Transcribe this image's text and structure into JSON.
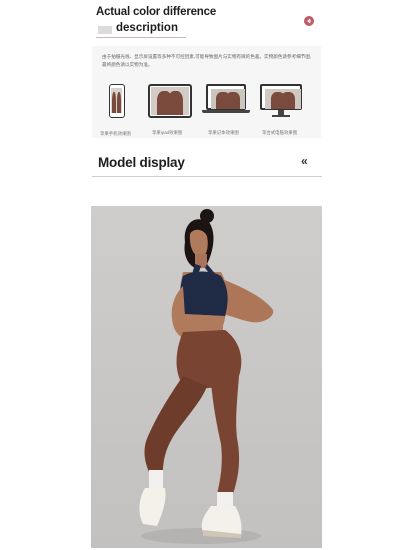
{
  "header": {
    "title_line1": "Actual color difference",
    "title_line2": "description"
  },
  "color_note": {
    "text": "由于拍摄光线、显示屏设置等多种不可控因素,可能导致图片与实物有微的色差。实物颜色请参考细节图,最终颜色请以实物为准。",
    "devices": [
      {
        "label": "苹果手机效果图",
        "icon": "phone-icon"
      },
      {
        "label": "苹果ipad效果图",
        "icon": "tablet-icon"
      },
      {
        "label": "苹果记本效果图",
        "icon": "laptop-icon"
      },
      {
        "label": "苹台式电脑效果图",
        "icon": "monitor-icon"
      }
    ]
  },
  "model_section": {
    "title": "Model display",
    "chevron": "«"
  },
  "colors": {
    "accent": "#c0596a",
    "legging": "#7a4432",
    "bra": "#1f2a44",
    "background": "#c6c4c2"
  }
}
